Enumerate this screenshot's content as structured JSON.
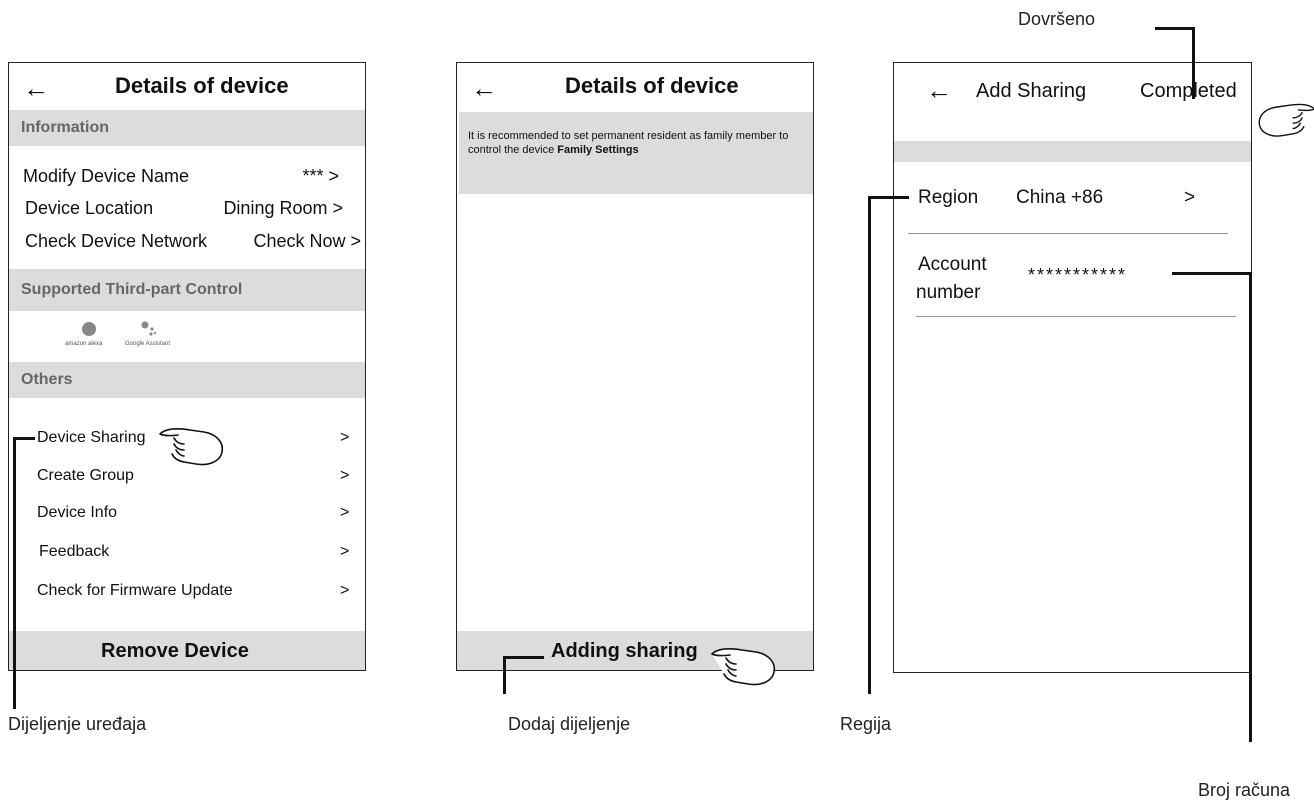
{
  "screen1": {
    "title": "Details of device",
    "back_icon": "arrow-left-icon",
    "section_information": "Information",
    "modify_name_label": "Modify Device Name",
    "modify_name_value": "*** >",
    "location_label": "Device Location",
    "location_value": "Dining Room >",
    "network_label": "Check Device Network",
    "network_value": "Check Now >",
    "section_third_party": "Supported Third-part Control",
    "alexa_label": "amazon alexa",
    "google_label": "Google Assistant",
    "section_others": "Others",
    "items": [
      {
        "label": "Device Sharing",
        "chevron": ">"
      },
      {
        "label": "Create Group",
        "chevron": ">"
      },
      {
        "label": "Device Info",
        "chevron": ">"
      },
      {
        "label": "Feedback",
        "chevron": ">"
      },
      {
        "label": "Check for Firmware Update",
        "chevron": ">"
      }
    ],
    "remove_button": "Remove Device"
  },
  "screen2": {
    "title": "Details of device",
    "back_icon": "arrow-left-icon",
    "notice_text": "It is recommended to set permanent resident as family member to control the device",
    "notice_link": "Family Settings",
    "adding_button": "Adding sharing"
  },
  "screen3": {
    "title": "Add Sharing",
    "back_icon": "arrow-left-icon",
    "completed_button": "Completed",
    "region_label": "Region",
    "region_value": "China +86",
    "region_chevron": ">",
    "account_label_line1": "Account",
    "account_label_line2": "number",
    "account_value": "***********"
  },
  "annotations": {
    "device_sharing": "Dijeljenje uređaja",
    "adding_sharing": "Dodaj dijeljenje",
    "region": "Regija",
    "completed": "Dovršeno",
    "account_number": "Broj računa"
  },
  "colors": {
    "section_bg": "#dcdcdc",
    "border": "#222222"
  }
}
